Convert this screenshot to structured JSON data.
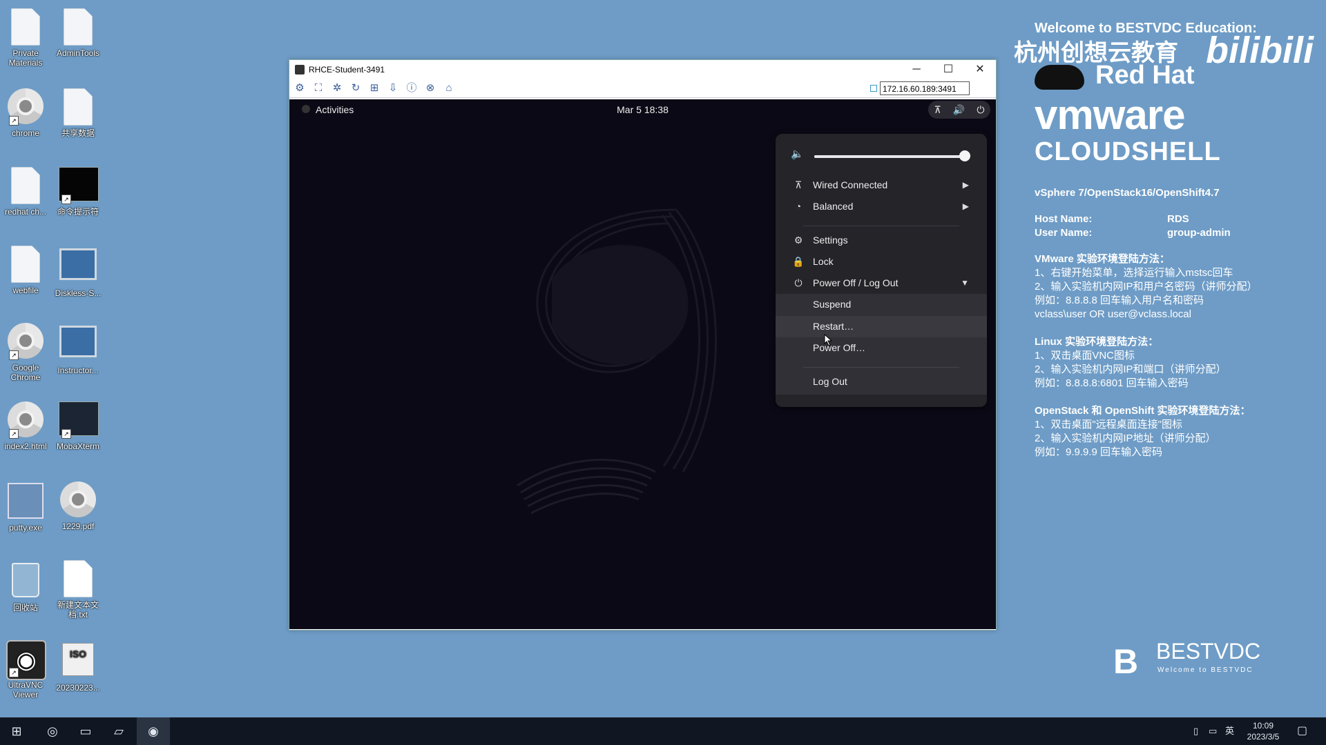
{
  "desktop": {
    "icons": [
      {
        "label": "Private Materials"
      },
      {
        "label": "AdminTools"
      },
      {
        "label": "chrome"
      },
      {
        "label": "共享数据"
      },
      {
        "label": "redhat ch..."
      },
      {
        "label": "命令提示符"
      },
      {
        "label": "webfile"
      },
      {
        "label": "Diskless-S..."
      },
      {
        "label": "Google Chrome"
      },
      {
        "label": "Instructor..."
      },
      {
        "label": "index2.html"
      },
      {
        "label": "MobaXterm"
      },
      {
        "label": "putty.exe"
      },
      {
        "label": "1229.pdf"
      },
      {
        "label": "回收站"
      },
      {
        "label": "新建文本文档.txt"
      },
      {
        "label": "UltraVNC Viewer"
      },
      {
        "label": "20230223..."
      }
    ]
  },
  "vnc_window": {
    "title": "RHCE-Student-3491",
    "host": "172.16.60.189:3491",
    "minimize": "─",
    "maximize": "☐",
    "close": "✕"
  },
  "gnome": {
    "activities": "Activities",
    "clock": "Mar 5  18:38"
  },
  "menu": {
    "volume_level": 1.0,
    "items": [
      {
        "label": "Wired Connected",
        "icon": "network-icon"
      },
      {
        "label": "Balanced",
        "icon": "power-profile-icon"
      },
      {
        "label": "Settings",
        "icon": "gear-icon"
      },
      {
        "label": "Lock",
        "icon": "lock-icon"
      },
      {
        "label": "Power Off / Log Out",
        "icon": "power-icon"
      }
    ],
    "submenu": [
      "Suspend",
      "Restart…",
      "Power Off…",
      "Log Out"
    ]
  },
  "info": {
    "welcome": "Welcome to BESTVDC Education:",
    "cn_title": "杭州创想云教育",
    "redhat": "Red Hat",
    "vmware": "vmware",
    "cloudshell": "CLOUDSHELL",
    "bilibili": "bilibili",
    "platforms": "vSphere 7/OpenStack16/OpenShift4.7",
    "host_label": "Host Name:",
    "host_value": "RDS",
    "user_label": "User Name:",
    "user_value": "group-admin",
    "vmware_block": [
      "VMware 实验环境登陆方法：",
      "1、右键开始菜单，选择运行输入mstsc回车",
      "2、输入实验机内网IP和用户名密码（讲师分配）",
      "例如：8.8.8.8 回车输入用户名和密码",
      "vclass\\user  OR  user@vclass.local"
    ],
    "linux_block": [
      "Linux 实验环境登陆方法：",
      "1、双击桌面VNC图标",
      "2、输入实验机内网IP和端口（讲师分配）",
      "例如：8.8.8.8:6801 回车输入密码"
    ],
    "openstack_block": [
      "OpenStack 和 OpenShift 实验环境登陆方法：",
      "1、双击桌面\"远程桌面连接\"图标",
      "2、输入实验机内网IP地址（讲师分配）",
      "例如：9.9.9.9   回车输入密码"
    ],
    "bestvdc": "BESTVDC",
    "bestvdc_sub": "Welcome to BESTVDC"
  },
  "taskbar": {
    "ime": "英",
    "time": "10:09",
    "date": "2023/3/5"
  }
}
